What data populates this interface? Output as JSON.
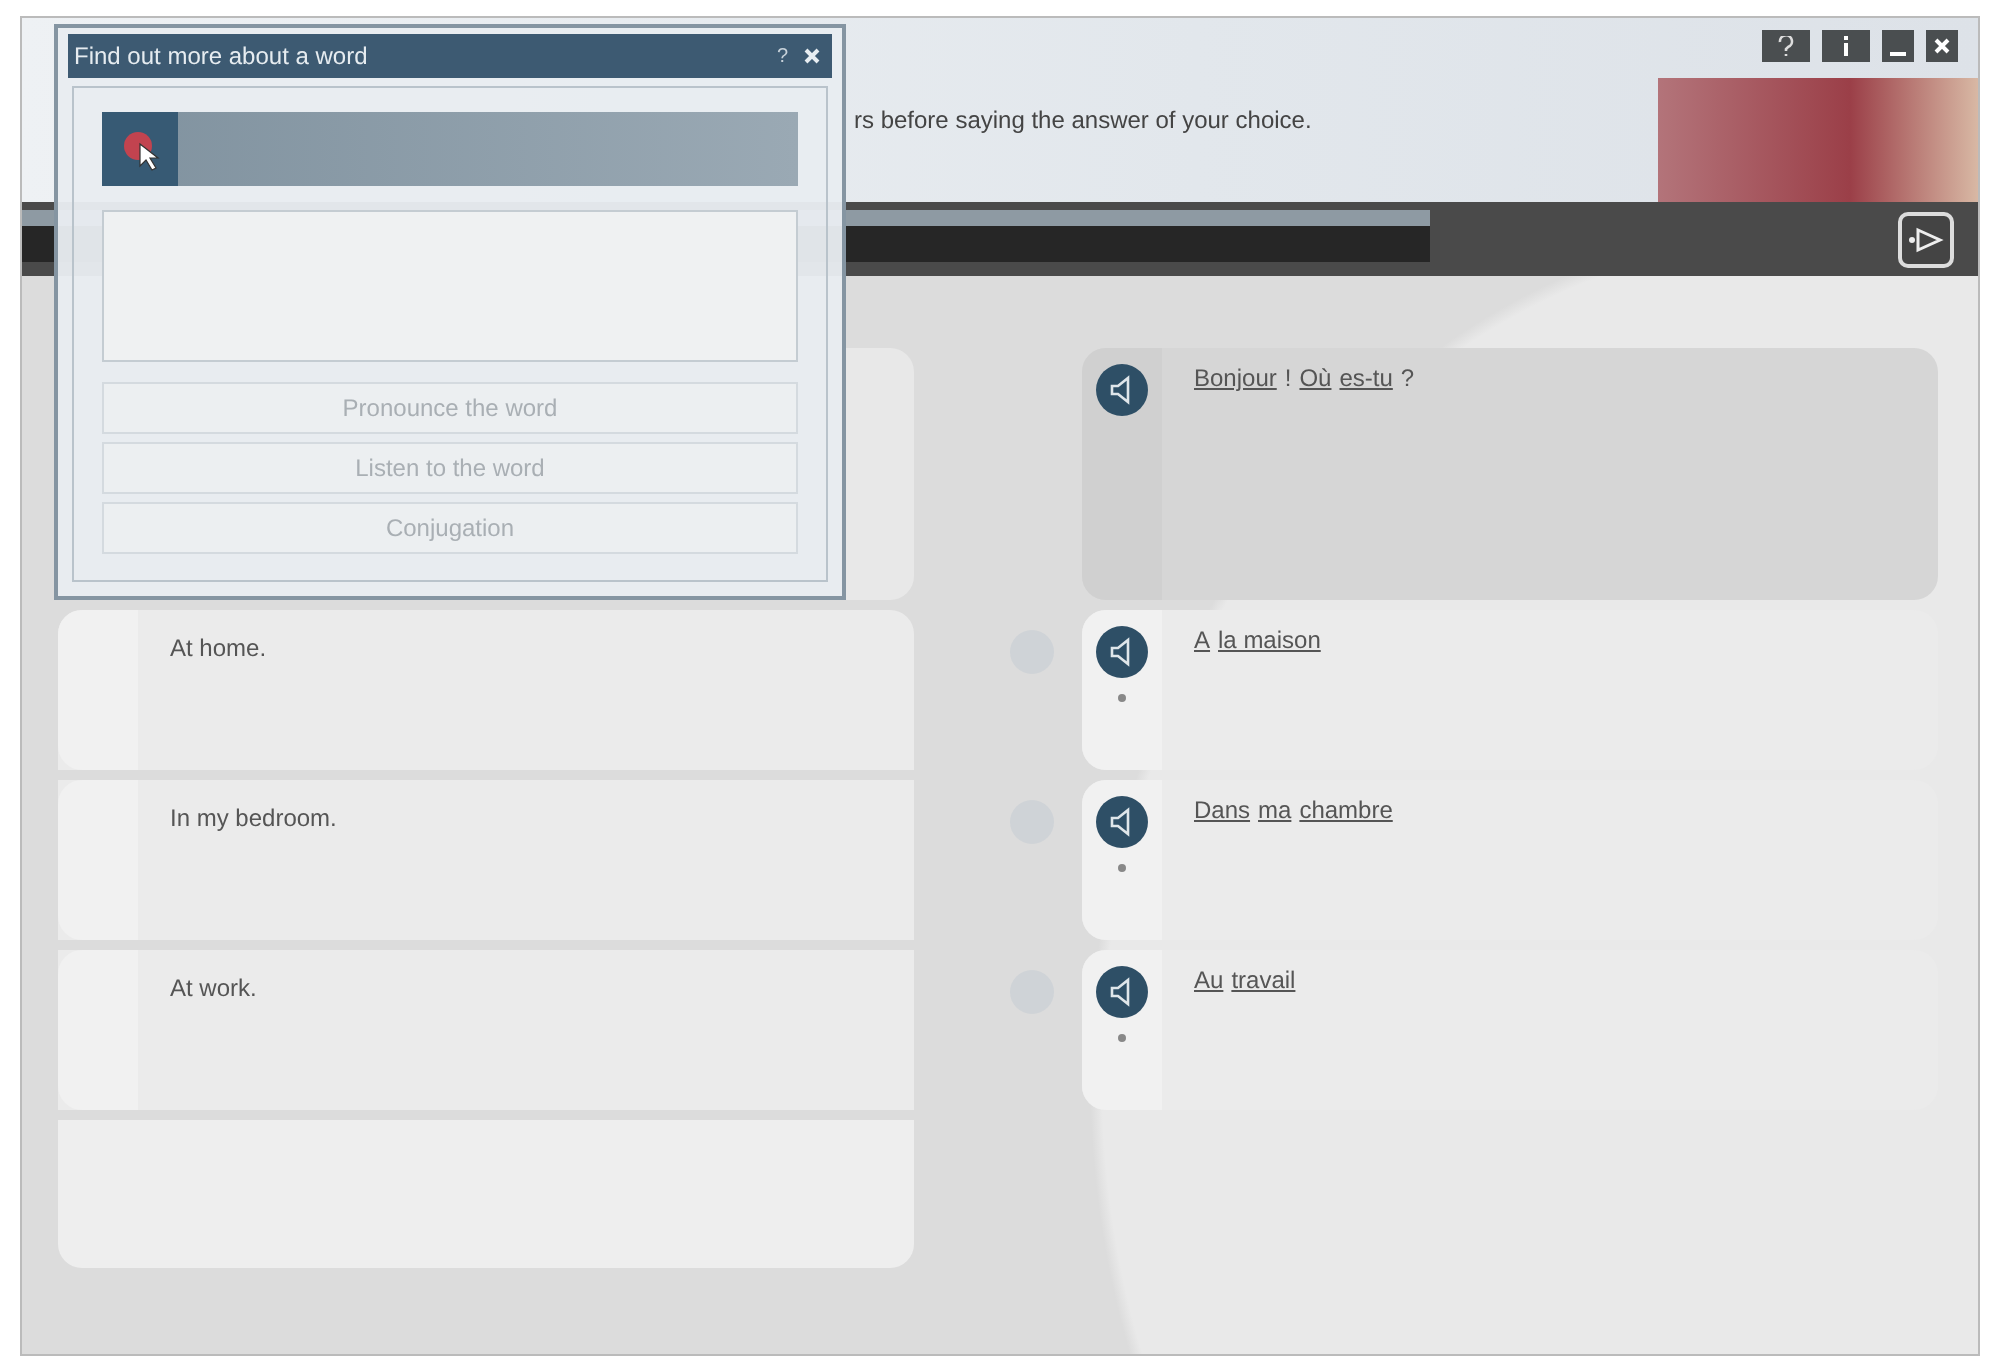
{
  "header": {
    "instruction": "rs before saying the answer of your choice."
  },
  "progress": {
    "level": 0.72
  },
  "question": {
    "words": [
      "Bonjour",
      "!",
      "Où",
      "es-tu",
      "?"
    ],
    "linked": [
      true,
      false,
      true,
      true,
      false
    ]
  },
  "prompts": [
    {
      "text": "At home."
    },
    {
      "text": "In my bedroom."
    },
    {
      "text": "At work."
    }
  ],
  "answers": [
    {
      "words": [
        "A",
        "la maison"
      ],
      "selected": false
    },
    {
      "words": [
        "Dans",
        "ma",
        "chambre"
      ],
      "selected": false
    },
    {
      "words": [
        "Au",
        "travail"
      ],
      "selected": false
    }
  ],
  "dialog": {
    "title": "Find out more about a word",
    "help": "?",
    "buttons": [
      {
        "label": "Pronounce the word",
        "disabled": true
      },
      {
        "label": "Listen to the word",
        "disabled": true
      },
      {
        "label": "Conjugation",
        "disabled": true
      }
    ]
  }
}
